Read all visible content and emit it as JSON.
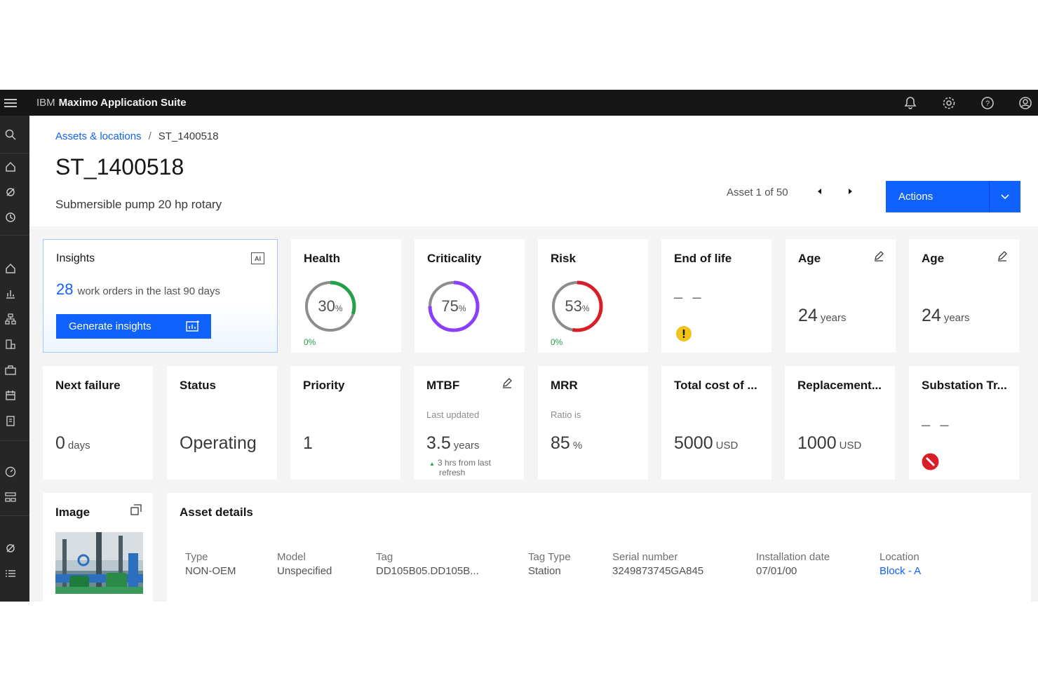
{
  "header": {
    "brand_ibm": "IBM",
    "brand_product": "Maximo Application Suite",
    "icons": [
      "menu-icon",
      "notification-icon",
      "settings-icon",
      "help-icon",
      "user-icon"
    ]
  },
  "rail": {
    "icons": [
      "search-icon",
      "home-icon",
      "asset-icon",
      "history-icon",
      "home-icon",
      "chart-icon",
      "hierarchy-icon",
      "inventory-icon",
      "toolbox-icon",
      "calendar-icon",
      "clipboard-icon",
      "gauge-icon",
      "structure-icon",
      "tag-icon",
      "list-icon"
    ]
  },
  "breadcrumb": {
    "parent": "Assets & locations",
    "separator": "/",
    "current": "ST_1400518"
  },
  "page": {
    "title": "ST_1400518",
    "subtitle": "Submersible pump 20 hp rotary"
  },
  "pager": {
    "text": "Asset 1 of 50"
  },
  "actions": {
    "label": "Actions"
  },
  "insights": {
    "title": "Insights",
    "badge": "AI",
    "count": "28",
    "text": "work orders in the last 90 days",
    "button": "Generate insights"
  },
  "kpis": {
    "health": {
      "title": "Health",
      "value": 30,
      "unit": "%",
      "change": "0%",
      "color": "#24a148"
    },
    "criticality": {
      "title": "Criticality",
      "value": 75,
      "unit": "%",
      "color": "#8a3ffc"
    },
    "risk": {
      "title": "Risk",
      "value": 53,
      "unit": "%",
      "change": "0%",
      "color": "#da1e28"
    },
    "end_of_life": {
      "title": "End of life",
      "value": "– –",
      "status": "warning",
      "status_color": "#f1c21b"
    },
    "age1": {
      "title": "Age",
      "value": "24",
      "unit": "years"
    },
    "age2": {
      "title": "Age",
      "value": "24",
      "unit": "years"
    },
    "next_failure": {
      "title": "Next failure",
      "value": "0",
      "unit": "days"
    },
    "status": {
      "title": "Status",
      "value": "Operating"
    },
    "priority": {
      "title": "Priority",
      "value": "1"
    },
    "mtbf": {
      "title": "MTBF",
      "sub": "Last updated",
      "value": "3.5",
      "unit": "years",
      "note_line1": "3 hrs from last",
      "note_line2": "refresh"
    },
    "mrr": {
      "title": "MRR",
      "sub": "Ratio is",
      "value": "85",
      "unit": "%"
    },
    "total_cost": {
      "title": "Total cost of ...",
      "value": "5000",
      "unit": "USD"
    },
    "replacement": {
      "title": "Replacement...",
      "value": "1000",
      "unit": "USD"
    },
    "substation": {
      "title": "Substation Tr...",
      "value": "– –",
      "status": "blocked",
      "status_color": "#da1e28"
    }
  },
  "image_card": {
    "title": "Image"
  },
  "asset_details": {
    "title": "Asset details",
    "fields": [
      {
        "label": "Type",
        "value": "NON-OEM"
      },
      {
        "label": "Model",
        "value": "Unspecified"
      },
      {
        "label": "Tag",
        "value": "DD105B05.DD105B..."
      },
      {
        "label": "Tag Type",
        "value": "Station"
      },
      {
        "label": "Serial number",
        "value": "3249873745GA845"
      },
      {
        "label": "Installation date",
        "value": "07/01/00"
      },
      {
        "label": "Location",
        "value": "Block - A"
      }
    ]
  }
}
